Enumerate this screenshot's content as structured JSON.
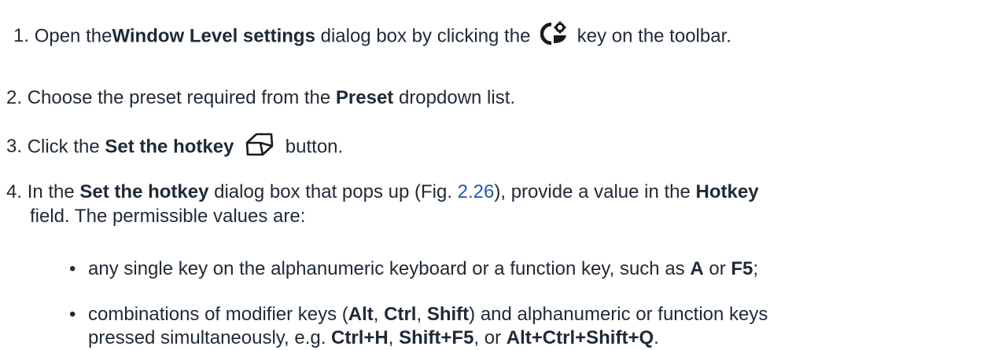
{
  "steps": [
    {
      "number": "1.",
      "pre": "Open the",
      "bold": "Window Level settings",
      "mid": " dialog box by clicking the ",
      "icon": "window-level-settings-icon",
      "post": " key on the toolbar."
    },
    {
      "number": "2.",
      "pre": "Choose the preset required from the ",
      "bold": "Preset",
      "post": " dropdown list."
    },
    {
      "number": "3.",
      "pre": "Click the ",
      "bold": "Set the hotkey",
      "icon": "hotkey-key-icon",
      "post": " button."
    },
    {
      "number": "4.",
      "pre": "In the ",
      "bold": "Set the hotkey",
      "mid": " dialog box that pops up (Fig. ",
      "link": "2.26",
      "mid2": "), provide a value in the ",
      "bold2": "Hotkey",
      "line2": "field. The permissible values are:"
    }
  ],
  "bullets": [
    {
      "pre": "any single key on the alphanumeric keyboard or a function key, such as ",
      "k1": "A",
      "mid": " or ",
      "k2": "F5",
      "post": ";"
    },
    {
      "pre": "combinations of modifier keys (",
      "k1": "Alt",
      "s1": ", ",
      "k2": "Ctrl",
      "s2": ", ",
      "k3": "Shift",
      "mid": ") and alphanumeric or function keys",
      "line2_pre": "pressed simultaneously, e.g. ",
      "e1": "Ctrl+H",
      "s3": ", ",
      "e2": "Shift+F5",
      "s4": ", or ",
      "e3": "Alt+Ctrl+Shift+Q",
      "post": "."
    }
  ]
}
